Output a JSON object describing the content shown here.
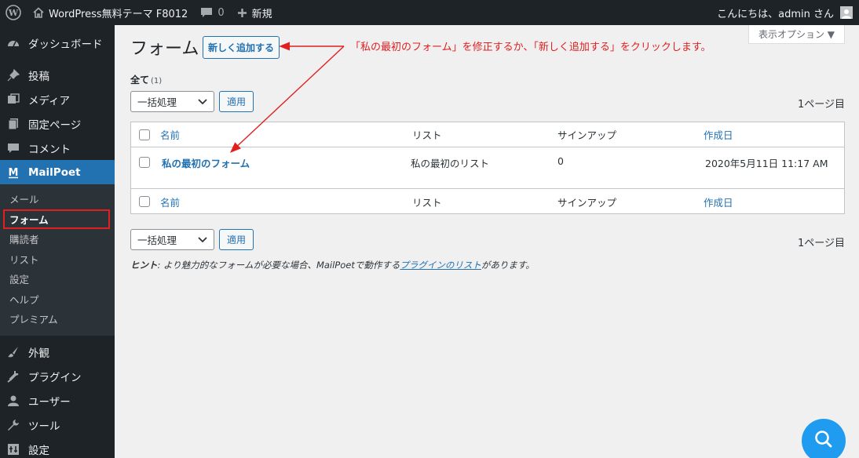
{
  "adminbar": {
    "site_name": "WordPress無料テーマ F8012",
    "comments_count": "0",
    "new_label": "新規",
    "greeting": "こんにちは、admin さん"
  },
  "sidebar": {
    "top_items": [
      {
        "label": "ダッシュボード",
        "icon": "dashboard-icon"
      },
      {
        "label": "投稿",
        "icon": "pin-icon"
      },
      {
        "label": "メディア",
        "icon": "media-icon"
      },
      {
        "label": "固定ページ",
        "icon": "page-icon"
      },
      {
        "label": "コメント",
        "icon": "comment-icon"
      }
    ],
    "active_item": {
      "label": "MailPoet",
      "icon": "mailpoet-icon"
    },
    "submenu": [
      "メール",
      "フォーム",
      "購読者",
      "リスト",
      "設定",
      "ヘルプ",
      "プレミアム"
    ],
    "bottom_items": [
      {
        "label": "外観",
        "icon": "brush-icon"
      },
      {
        "label": "プラグイン",
        "icon": "plugin-icon"
      },
      {
        "label": "ユーザー",
        "icon": "user-icon"
      },
      {
        "label": "ツール",
        "icon": "wrench-icon"
      },
      {
        "label": "設定",
        "icon": "settings-icon"
      }
    ]
  },
  "main": {
    "screen_options": "表示オプション ▼",
    "title": "フォーム",
    "add_new": "新しく追加する",
    "annotation": "「私の最初のフォーム」を修正するか、「新しく追加する」をクリックします。",
    "filter_all": "全て",
    "filter_count": "(1)",
    "bulk_action": "一括処理",
    "apply": "適用",
    "page_count": "1ページ目",
    "columns": {
      "name": "名前",
      "list": "リスト",
      "signups": "サインアップ",
      "created": "作成日"
    },
    "rows": [
      {
        "name": "私の最初のフォーム",
        "list": "私の最初のリスト",
        "signups": "0",
        "created": "2020年5月11日 11:17 AM"
      }
    ],
    "hint_label": "ヒント",
    "hint_text": ": より魅力的なフォームが必要な場合、MailPoetで動作する",
    "hint_link": "プラグインのリスト",
    "hint_suffix": "があります。"
  },
  "colors": {
    "accent": "#2271b1",
    "annotation": "#e02020",
    "sidebar_bg": "#1d2327"
  }
}
